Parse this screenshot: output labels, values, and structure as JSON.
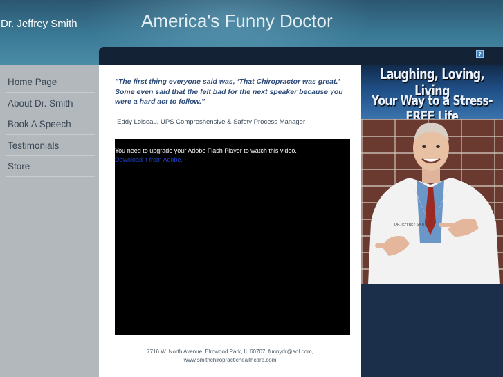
{
  "header": {
    "site_name": "Dr. Jeffrey Smith",
    "title": "America's Funny Doctor",
    "top_bar_icon": "?"
  },
  "nav": {
    "items": [
      {
        "label": "Home Page"
      },
      {
        "label": "About Dr. Smith"
      },
      {
        "label": "Book A Speech"
      },
      {
        "label": "Testimonials"
      },
      {
        "label": "Store"
      }
    ]
  },
  "content": {
    "quote": "\"The first thing everyone said was, ‘That Chiropractor was great.’ Some even said that the felt bad for the next speaker because you were a hard act to follow.\"",
    "attribution": "-Eddy Loiseau, UPS Compreshensive & Safety Process Manager",
    "video": {
      "message": "You need to upgrade your Adobe Flash Player to watch this video.",
      "link_text": "Download it from Adobe."
    },
    "footer_line1": "7716 W. North Avenue, Elmwood Park, IL 60707, funnydr@aol.com,",
    "footer_line2": "www.smithchiropractichealthcare.com"
  },
  "banner": {
    "line1": "Laughing, Loving, Living",
    "line2": "Your Way to a Stress-FREE Life",
    "doctor_badge": "DR. JEFFREY SMITH"
  },
  "colors": {
    "page_background": "#1c2f4a",
    "sidebar_background": "#b2b8bc",
    "quote_text": "#2e4b78"
  }
}
